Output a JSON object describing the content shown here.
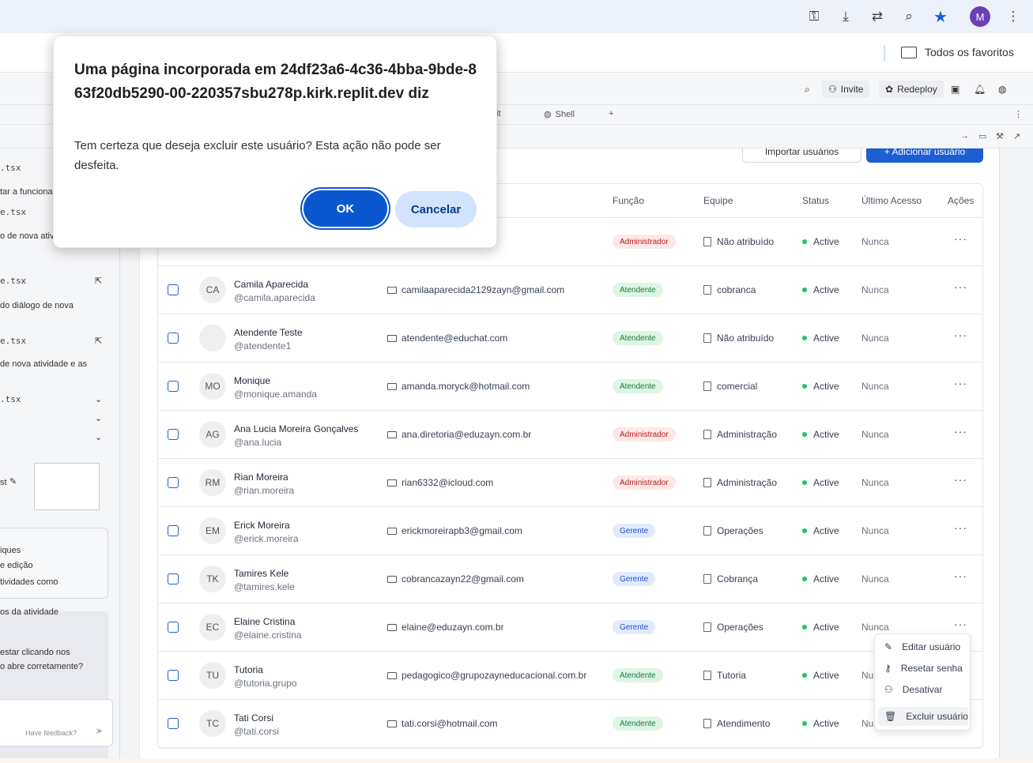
{
  "browser": {
    "icons": [
      "key-icon",
      "install-icon",
      "translate-icon",
      "zoom-icon",
      "bookmark-star-icon"
    ],
    "profile_initial": "M",
    "bookmarks_all": "Todos os favoritos"
  },
  "replit": {
    "invite": "Invite",
    "redeploy": "Redeploy",
    "tabs": [
      "it",
      "Shell",
      "+"
    ],
    "left_panel": {
      "files": [
        ".tsx",
        "e.tsx",
        "e.tsx",
        "e.tsx",
        ".tsx"
      ],
      "snippets": [
        "tar a funciona",
        "o de nova ativ",
        "do diálogo de nova",
        "de nova atividade e as"
      ],
      "checkpoint": "st",
      "notes": [
        "iques",
        "e edição",
        "tividades como",
        "os da atividade",
        "estar clicando nos",
        "o abre corretamente?"
      ],
      "feedback_placeholder": "Have feedback?"
    }
  },
  "users_page": {
    "import_button": "Importar usuários",
    "add_button": "+ Adicionar usuário",
    "columns": {
      "role": "Função",
      "team": "Equipe",
      "status": "Status",
      "last_access": "Último Acesso",
      "actions": "Ações"
    },
    "rows": [
      {
        "initials": "",
        "name": "",
        "handle": "",
        "email": "",
        "role": "Administrador",
        "role_kind": "admin",
        "team": "Não atribuído",
        "status": "Active",
        "last": "Nunca"
      },
      {
        "initials": "CA",
        "name": "Camila Aparecida",
        "handle": "@camila.aparecida",
        "email": "camilaaparecida2129zayn@gmail.com",
        "role": "Atendente",
        "role_kind": "atend",
        "team": "cobranca",
        "status": "Active",
        "last": "Nunca"
      },
      {
        "initials": "",
        "name": "Atendente Teste",
        "handle": "@atendente1",
        "email": "atendente@educhat.com",
        "role": "Atendente",
        "role_kind": "atend",
        "team": "Não atribuído",
        "status": "Active",
        "last": "Nunca"
      },
      {
        "initials": "MO",
        "name": "Monique",
        "handle": "@monique.amanda",
        "email": "amanda.moryck@hotmail.com",
        "role": "Atendente",
        "role_kind": "atend",
        "team": "comercial",
        "status": "Active",
        "last": "Nunca"
      },
      {
        "initials": "AG",
        "name": "Ana Lucia Moreira Gonçalves",
        "handle": "@ana.lucia",
        "email": "ana.diretoria@eduzayn.com.br",
        "role": "Administrador",
        "role_kind": "admin",
        "team": "Administração",
        "status": "Active",
        "last": "Nunca"
      },
      {
        "initials": "RM",
        "name": "Rian Moreira",
        "handle": "@rian.moreira",
        "email": "rian6332@icloud.com",
        "role": "Administrador",
        "role_kind": "admin",
        "team": "Administração",
        "status": "Active",
        "last": "Nunca"
      },
      {
        "initials": "EM",
        "name": "Erick Moreira",
        "handle": "@erick.moreira",
        "email": "erickmoreirapb3@gmail.com",
        "role": "Gerente",
        "role_kind": "ger",
        "team": "Operações",
        "status": "Active",
        "last": "Nunca"
      },
      {
        "initials": "TK",
        "name": "Tamires Kele",
        "handle": "@tamires.kele",
        "email": "cobrancazayn22@gmail.com",
        "role": "Gerente",
        "role_kind": "ger",
        "team": "Cobrança",
        "status": "Active",
        "last": "Nunca"
      },
      {
        "initials": "EC",
        "name": "Elaine Cristina",
        "handle": "@elaine.cristina",
        "email": "elaine@eduzayn.com.br",
        "role": "Gerente",
        "role_kind": "ger",
        "team": "Operações",
        "status": "Active",
        "last": "Nunca"
      },
      {
        "initials": "TU",
        "name": "Tutoria",
        "handle": "@tutoria.grupo",
        "email": "pedagogico@grupozayneducacional.com.br",
        "role": "Atendente",
        "role_kind": "atend",
        "team": "Tutoria",
        "status": "Active",
        "last": "Nun"
      },
      {
        "initials": "TC",
        "name": "Tati Corsi",
        "handle": "@tati.corsi",
        "email": "tati.corsi@hotmail.com",
        "role": "Atendente",
        "role_kind": "atend",
        "team": "Atendimento",
        "status": "Active",
        "last": "Nun"
      }
    ],
    "context_menu": {
      "edit": "Editar usuário",
      "reset": "Resetar senha",
      "deactivate": "Desativar",
      "delete": "Excluir usuário"
    }
  },
  "dialog": {
    "title": "Uma página incorporada em 24df23a6-4c36-4bba-9bde-863f20db5290-00-220357sbu278p.kirk.replit.dev diz",
    "message": "Tem certeza que deseja excluir este usuário? Esta ação não pode ser desfeita.",
    "ok": "OK",
    "cancel": "Cancelar"
  }
}
